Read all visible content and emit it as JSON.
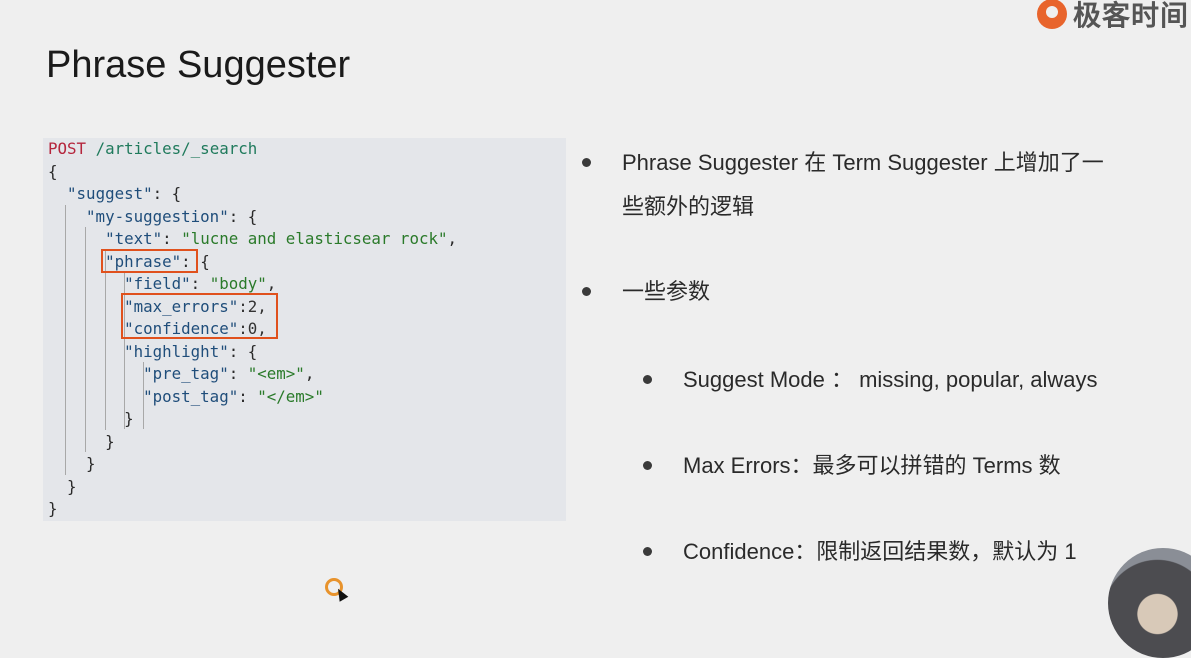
{
  "brand": {
    "name": "极客时间",
    "accent": "#e8642c"
  },
  "slide": {
    "title": "Phrase Suggester"
  },
  "code": {
    "method": "POST",
    "path": "/articles/_search",
    "lines": {
      "l2": "{",
      "l3_key": "\"suggest\"",
      "l3_rest": ": {",
      "l4_key": "\"my-suggestion\"",
      "l4_rest": ": {",
      "l5_key": "\"text\"",
      "l5_sep": ": ",
      "l5_val": "\"lucne and elasticsear rock\"",
      "l5_end": ",",
      "l6_key": "\"phrase\"",
      "l6_rest": ": {",
      "l7_key": "\"field\"",
      "l7_sep": ": ",
      "l7_val": "\"body\"",
      "l7_end": ",",
      "l8_key": "\"max_errors\"",
      "l8_rest": ":2,",
      "l9_key": "\"confidence\"",
      "l9_rest": ":0,",
      "l10_key": "\"highlight\"",
      "l10_rest": ": {",
      "l11_key": "\"pre_tag\"",
      "l11_sep": ": ",
      "l11_val": "\"<em>\"",
      "l11_end": ",",
      "l12_key": "\"post_tag\"",
      "l12_sep": ": ",
      "l12_val": "\"</em>\"",
      "l13": "}",
      "l14": "}",
      "l15": "}",
      "l16": "}",
      "l17": "}"
    }
  },
  "bullets": {
    "item1_line1": "Phrase Suggester 在 Term Suggester 上增加了一",
    "item1_line2": "些额外的逻辑",
    "item2": "一些参数",
    "sub1": "Suggest Mode ： missing, popular, always",
    "sub2": "Max Errors：最多可以拼错的 Terms 数",
    "sub3": "Confidence：限制返回结果数，默认为 1"
  },
  "colors": {
    "highlight_box": "#e0511d",
    "code_background": "#e4e6ea",
    "slide_background": "#efefef"
  }
}
